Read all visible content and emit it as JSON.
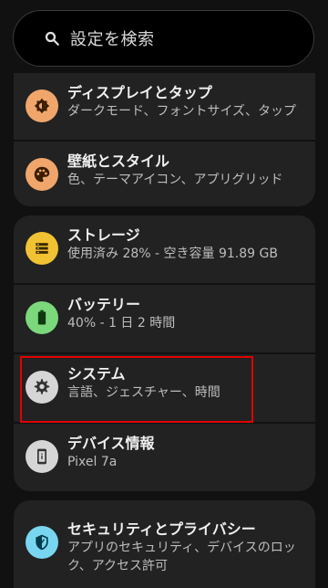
{
  "search": {
    "placeholder": "設定を検索"
  },
  "settings": {
    "display": {
      "title": "ディスプレイとタップ",
      "subtitle": "ダークモード、フォントサイズ、タップ",
      "icon": "display-icon",
      "color": "#f0a66b"
    },
    "wallpaper": {
      "title": "壁紙とスタイル",
      "subtitle": "色、テーマアイコン、アプリグリッド",
      "icon": "palette-icon",
      "color": "#f0a66b"
    },
    "storage": {
      "title": "ストレージ",
      "subtitle": "使用済み 28% - 空き容量 91.89 GB",
      "icon": "storage-icon",
      "color": "#f1c232"
    },
    "battery": {
      "title": "バッテリー",
      "subtitle": "40% - 1 日 2 時間",
      "icon": "battery-icon",
      "color": "#7bd87b"
    },
    "system": {
      "title": "システム",
      "subtitle": "言語、ジェスチャー、時間",
      "icon": "gear-icon",
      "color": "#d6d6d6"
    },
    "device": {
      "title": "デバイス情報",
      "subtitle": "Pixel 7a",
      "icon": "phone-info-icon",
      "color": "#d6d6d6"
    },
    "security": {
      "title": "セキュリティとプライバシー",
      "subtitle_line1": "アプリのセキュリティ、デバイスのロッ",
      "subtitle_line2": "ク、アクセス許可",
      "icon": "shield-icon",
      "color": "#79d6f0"
    }
  },
  "highlight_color": "#e00000"
}
